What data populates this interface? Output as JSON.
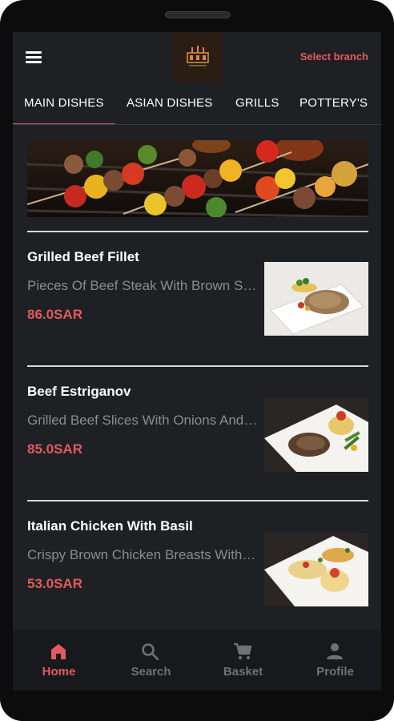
{
  "header": {
    "select_branch": "Select branch",
    "logo_icon": "restaurant-logo-icon"
  },
  "tabs": [
    {
      "label": "MAIN DISHES",
      "active": true
    },
    {
      "label": "ASIAN DISHES",
      "active": false
    },
    {
      "label": "GRILLS",
      "active": false
    },
    {
      "label": "POTTERY'S",
      "active": false
    }
  ],
  "dishes": [
    {
      "name": "Grilled Beef Fillet",
      "description": "Pieces Of Beef Steak With Brown Sauce",
      "price": "86.0SAR"
    },
    {
      "name": "Beef Estriganov",
      "description": "Grilled Beef Slices With Onions And Mushrooms",
      "price": "85.0SAR"
    },
    {
      "name": "Italian Chicken With Basil",
      "description": "Crispy Brown Chicken Breasts With Basil",
      "price": "53.0SAR"
    }
  ],
  "bottom_nav": [
    {
      "label": "Home",
      "icon": "home-icon",
      "active": true
    },
    {
      "label": "Search",
      "icon": "search-icon",
      "active": false
    },
    {
      "label": "Basket",
      "icon": "cart-icon",
      "active": false
    },
    {
      "label": "Profile",
      "icon": "person-icon",
      "active": false
    }
  ],
  "colors": {
    "accent": "#e05a5f",
    "background": "#1f2024",
    "muted_text": "#8a8b90"
  }
}
